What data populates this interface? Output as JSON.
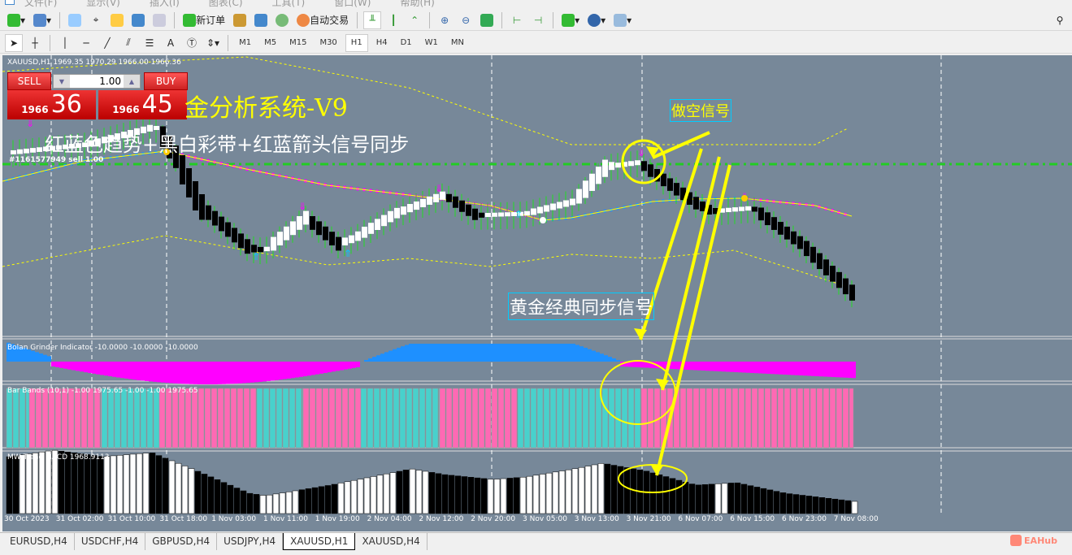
{
  "menu": [
    "文件(F)",
    "显示(V)",
    "插入(I)",
    "图表(C)",
    "工具(T)",
    "窗口(W)",
    "帮助(H)"
  ],
  "toolbar": {
    "new_order": "新订单",
    "auto_trading": "自动交易"
  },
  "timeframes": [
    "M1",
    "M5",
    "M15",
    "M30",
    "H1",
    "H4",
    "D1",
    "W1",
    "MN"
  ],
  "active_timeframe": "H1",
  "chart": {
    "header": "XAUUSD,H1  1969.35 1970.29 1966.00 1966.36",
    "sell_label": "SELL",
    "buy_label": "BUY",
    "lot": "1.00",
    "sell_big": "1966",
    "sell_small": "36",
    "buy_big": "1966",
    "buy_small": "45",
    "title": "金分析系统-V9",
    "subtitle": "红蓝色趋势+黑白彩带+红蓝箭头信号同步",
    "order_label": "#1161577949 sell 1.00",
    "short_signal": "做空信号",
    "gold_signal": "黄金经典同步信号"
  },
  "indicators": {
    "bolan": "Bolan Grinder Indicator -10.0000 -10.0000 -10.0000",
    "barbands": "Bar Bands (10,1) -1.00 1975.65 -1.00 -1.00 1975.65",
    "macd": "MW Trend MACD 1968.9113"
  },
  "time_axis": [
    "30 Oct 2023",
    "31 Oct 02:00",
    "31 Oct 10:00",
    "31 Oct 18:00",
    "1 Nov 03:00",
    "1 Nov 11:00",
    "1 Nov 19:00",
    "2 Nov 04:00",
    "2 Nov 12:00",
    "2 Nov 20:00",
    "3 Nov 05:00",
    "3 Nov 13:00",
    "3 Nov 21:00",
    "6 Nov 07:00",
    "6 Nov 15:00",
    "6 Nov 23:00",
    "7 Nov 08:00"
  ],
  "tabs": [
    "EURUSD,H4",
    "USDCHF,H4",
    "GBPUSD,H4",
    "USDJPY,H4",
    "XAUUSD,H1",
    "XAUUSD,H4"
  ],
  "active_tab": "XAUUSD,H1",
  "watermark": "EAHub",
  "colors": {
    "bg": "#778899",
    "bull": "#ffffff",
    "bear": "#000000",
    "teal": "#48D1CC",
    "pink": "#FF69B4",
    "magenta": "#FF00FF",
    "blue": "#1E90FF",
    "signal": "#FFFF00"
  }
}
